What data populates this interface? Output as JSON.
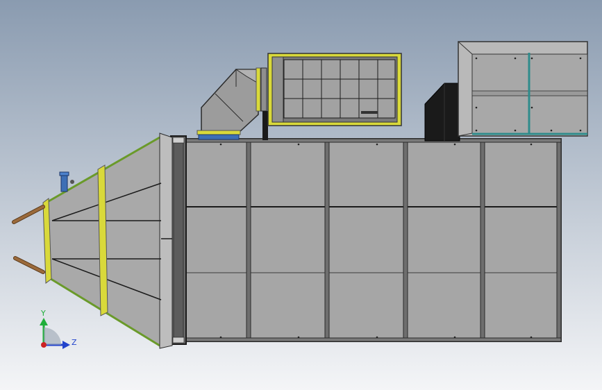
{
  "viewport": {
    "background_top": "#8a9bb0",
    "background_bottom": "#f4f5f7"
  },
  "model": {
    "steel_color": "#a6a6a6",
    "steel_dark": "#8f8f8f",
    "frame_line": "#2a2a2a",
    "flange_yellow": "#d9d93a",
    "green_edge": "#6a9a2a",
    "blue_flange": "#3d6fb5",
    "rust_rod": "#8b5a2b",
    "black_box": "#1a1a1a",
    "teal_frame": "#2e8b8b"
  },
  "triad": {
    "y_label": "Y",
    "z_label": "Z",
    "y_color": "#1fae3a",
    "z_color": "#2244cc",
    "x_color": "#cc2222"
  }
}
